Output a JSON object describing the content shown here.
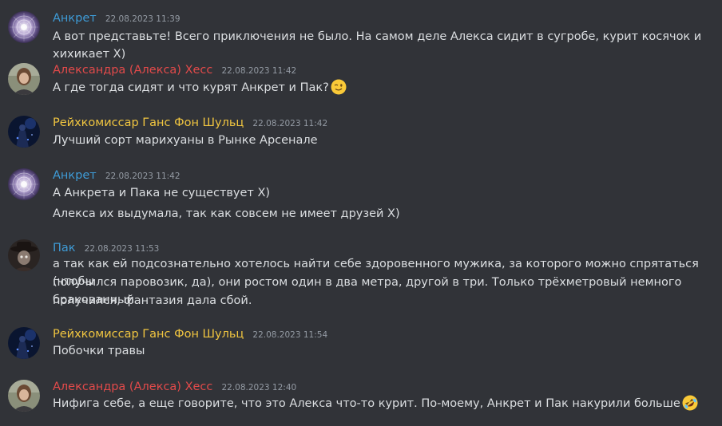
{
  "colors": {
    "background": "#313338",
    "ankret": "#3e9bd6",
    "aleksa": "#e24a4a",
    "reich": "#f0c540",
    "pak": "#3e9bd6",
    "timestamp": "#949ba4"
  },
  "messages": [
    {
      "author": "Анкрет",
      "timestamp": "22.08.2023 11:39",
      "avatar_icon": "mandala-avatar",
      "lines": [
        "А вот представьте! Всего приключения не было. На самом деле Алекса сидит в сугробе, курит косячок и хихикает Х)"
      ]
    },
    {
      "author": "Александра (Алекса) Хесс",
      "timestamp": "22.08.2023 11:42",
      "avatar_icon": "portrait-avatar",
      "lines": [
        "А где тогда сидят и что курят Анкрет и Пак?"
      ],
      "emoji": "winking-face-emoji"
    },
    {
      "author": "Рейхкомиссар Ганс Фон Шульц",
      "timestamp": "22.08.2023 11:42",
      "avatar_icon": "night-figure-avatar",
      "lines": [
        "Лучший сорт марихуаны в Рынке Арсенале"
      ]
    },
    {
      "author": "Анкрет",
      "timestamp": "22.08.2023 11:42",
      "avatar_icon": "mandala-avatar",
      "lines": [
        "А Анкрета и Пака не существует Х)",
        "Алекса их выдумала, так как совсем не имеет друзей Х)"
      ]
    },
    {
      "author": "Пак",
      "timestamp": "22.08.2023 11:53",
      "avatar_icon": "hat-man-avatar",
      "lines": [
        "а так как ей подсознательно хотелось найти себе здоровенного мужика, за которого можно спрятаться (чтобы",
        "получился паровозик, да), они ростом один в два метра, другой в три. Только трёхметровый немного бракованный",
        "получился, фантазия дала сбой."
      ]
    },
    {
      "author": "Рейхкомиссар Ганс Фон Шульц",
      "timestamp": "22.08.2023 11:54",
      "avatar_icon": "night-figure-avatar",
      "lines": [
        "Побочки травы"
      ]
    },
    {
      "author": "Александра (Алекса) Хесс",
      "timestamp": "22.08.2023 12:40",
      "avatar_icon": "portrait-avatar",
      "lines": [
        "Нифига себе, а еще говорите, что это Алекса что-то курит. По-моему, Анкрет и Пак накурили больше"
      ],
      "emoji": "rolling-laughing-emoji"
    }
  ]
}
